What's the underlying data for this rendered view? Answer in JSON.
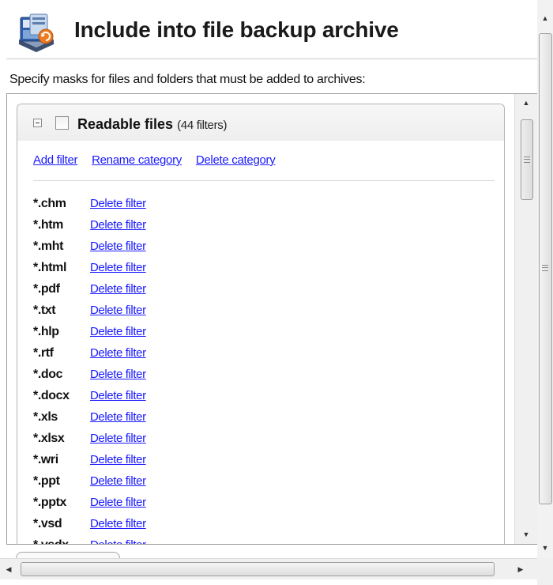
{
  "header": {
    "title": "Include into file backup archive",
    "icon": "backup-archive-icon"
  },
  "instructions": "Specify masks for files and folders that must be added to archives:",
  "category": {
    "name": "Readable files",
    "count": "(44 filters)",
    "checked": false,
    "expanded": true,
    "actions": {
      "add_filter": "Add filter",
      "rename_category": "Rename category",
      "delete_category": "Delete category"
    },
    "filters": [
      {
        "mask": "*.chm",
        "action": "Delete filter"
      },
      {
        "mask": "*.htm",
        "action": "Delete filter"
      },
      {
        "mask": "*.mht",
        "action": "Delete filter"
      },
      {
        "mask": "*.html",
        "action": "Delete filter"
      },
      {
        "mask": "*.pdf",
        "action": "Delete filter"
      },
      {
        "mask": "*.txt",
        "action": "Delete filter"
      },
      {
        "mask": "*.hlp",
        "action": "Delete filter"
      },
      {
        "mask": "*.rtf",
        "action": "Delete filter"
      },
      {
        "mask": "*.doc",
        "action": "Delete filter"
      },
      {
        "mask": "*.docx",
        "action": "Delete filter"
      },
      {
        "mask": "*.xls",
        "action": "Delete filter"
      },
      {
        "mask": "*.xlsx",
        "action": "Delete filter"
      },
      {
        "mask": "*.wri",
        "action": "Delete filter"
      },
      {
        "mask": "*.ppt",
        "action": "Delete filter"
      },
      {
        "mask": "*.pptx",
        "action": "Delete filter"
      },
      {
        "mask": "*.vsd",
        "action": "Delete filter"
      },
      {
        "mask": "*.vsdx",
        "action": "Delete filter"
      }
    ]
  },
  "colors": {
    "link": "#1a1aff",
    "title": "#1a1a1a",
    "panel_border": "#b5b5b5"
  }
}
